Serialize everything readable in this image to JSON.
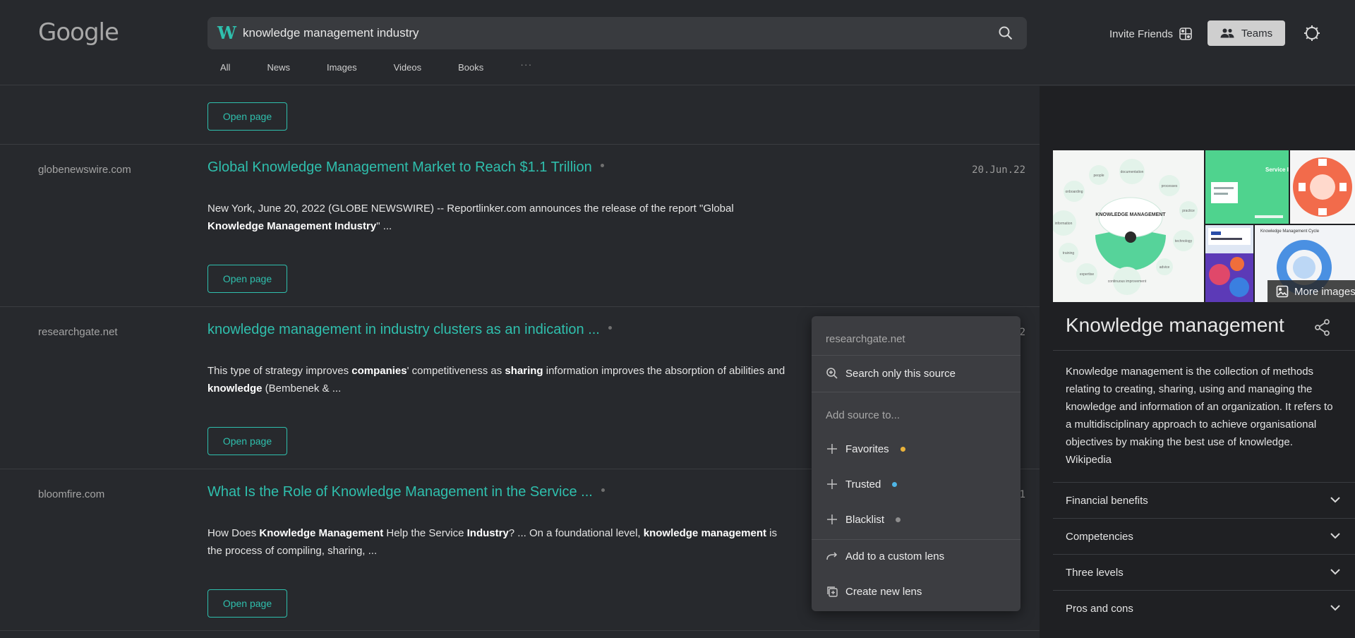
{
  "header": {
    "logo": "Google",
    "search_badge": "W",
    "search_query": "knowledge management industry",
    "tabs": [
      "All",
      "News",
      "Images",
      "Videos",
      "Books"
    ],
    "tabs_more": "···",
    "invite_label": "Invite Friends",
    "teams_label": "Teams"
  },
  "results": [
    {
      "open_label": "Open page"
    },
    {
      "domain": "globenewswire.com",
      "title": "Global Knowledge Management Market to Reach $1.1 Trillion",
      "date": "20.Jun.22",
      "snippet_parts": [
        "New York, June 20, 2022 (GLOBE NEWSWIRE) -- Reportlinker.com announces the release of the report \"Global ",
        "Knowledge Management Industry",
        "\" ..."
      ],
      "open_label": "Open page"
    },
    {
      "domain": "researchgate.net",
      "title": "knowledge management in industry clusters as an indication ...",
      "date_fragment": "2",
      "snippet_parts": [
        "This type of strategy improves ",
        "companies",
        "' competitiveness as ",
        "sharing",
        " information improves the absorption of abilities and ",
        "knowledge",
        " (Bembenek & ..."
      ],
      "open_label": "Open page"
    },
    {
      "domain": "bloomfire.com",
      "title": "What Is the Role of Knowledge Management in the Service ...",
      "date_fragment": "1",
      "snippet_parts": [
        "How Does ",
        "Knowledge Management",
        " Help the Service ",
        "Industry",
        "? ... On a foundational level, ",
        "knowledge management",
        " is the process of compiling, sharing, ..."
      ],
      "open_label": "Open page"
    }
  ],
  "panel": {
    "more_images_label": "More images",
    "image_labels": {
      "km_center": "KNOWLEDGE MANAGEMENT",
      "km_nodes": [
        "people",
        "documentation",
        "onboarding",
        "processes",
        "information",
        "practice",
        "technology",
        "training",
        "advice",
        "expertise",
        "continuous improvement"
      ],
      "img2_label": "Service I",
      "img5_label": "Knowledge Management Cycle"
    },
    "title": "Knowledge management",
    "description": "Knowledge management is the collection of methods relating to creating, sharing, using and managing the knowledge and information of an organization. It refers to a multidisciplinary approach to achieve organisational objectives by making the best use of knowledge. Wikipedia",
    "accordions": [
      "Financial benefits",
      "Competencies",
      "Three levels",
      "Pros and cons"
    ]
  },
  "menu": {
    "source": "researchgate.net",
    "search_only": "Search only this source",
    "add_section": "Add source to...",
    "favorites": "Favorites",
    "trusted": "Trusted",
    "blacklist": "Blacklist",
    "custom_lens": "Add to a custom lens",
    "new_lens": "Create new lens",
    "colors": {
      "favorites": "#e9b23a",
      "trusted": "#4fb6e6",
      "blacklist": "#8e8e8e"
    }
  },
  "colors": {
    "accent": "#2fbfad",
    "background": "#27292d",
    "panel": "#1f2023"
  }
}
